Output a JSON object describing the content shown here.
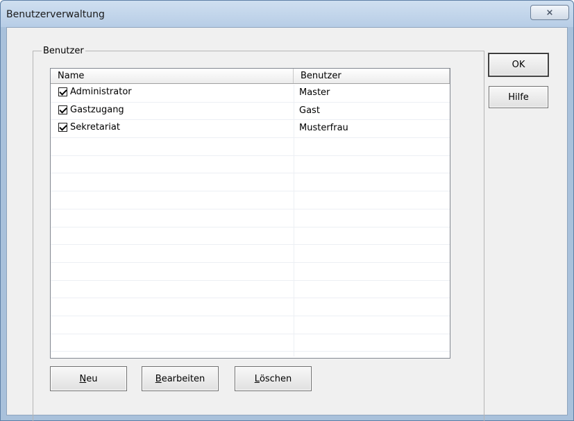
{
  "window": {
    "title": "Benutzerverwaltung"
  },
  "titlebar": {
    "close_label": "⨯"
  },
  "group": {
    "label": "Benutzer"
  },
  "list": {
    "columns": [
      "Name",
      "Benutzer"
    ],
    "rows": [
      {
        "name": "Administrator",
        "user": "Master",
        "checked": true
      },
      {
        "name": "Gastzugang",
        "user": "Gast",
        "checked": true
      },
      {
        "name": "Sekretariat",
        "user": "Musterfrau",
        "checked": true
      }
    ]
  },
  "buttons": {
    "new": {
      "access": "N",
      "rest": "eu"
    },
    "edit": {
      "access": "B",
      "rest": "earbeiten"
    },
    "delete": {
      "access": "L",
      "rest": "öschen"
    },
    "ok": "OK",
    "help": "Hilfe"
  }
}
